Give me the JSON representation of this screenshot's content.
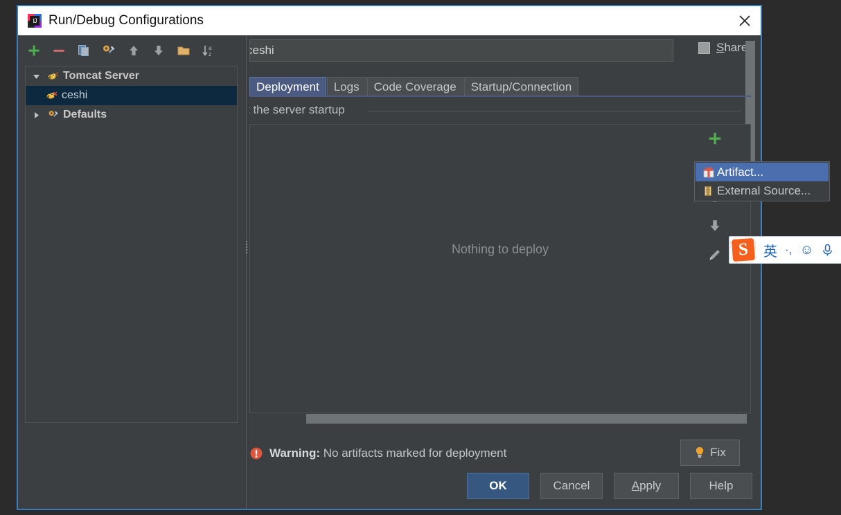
{
  "window": {
    "title": "Run/Debug Configurations",
    "app_icon": "intellij-idea-icon",
    "close_icon": "close-icon"
  },
  "left_toolbar": {
    "buttons": [
      {
        "name": "add-configuration-button",
        "icon": "plus-icon",
        "label": "+"
      },
      {
        "name": "remove-configuration-button",
        "icon": "minus-icon",
        "label": "-"
      },
      {
        "name": "copy-configuration-button",
        "icon": "copy-icon",
        "label": "Copy Configuration"
      },
      {
        "name": "edit-defaults-button",
        "icon": "wrench-gear-icon",
        "label": "Edit defaults"
      },
      {
        "name": "move-up-button",
        "icon": "arrow-up-icon",
        "label": "Move Up"
      },
      {
        "name": "move-down-button",
        "icon": "arrow-down-icon",
        "label": "Move Down"
      },
      {
        "name": "create-folder-button",
        "icon": "folder-icon",
        "label": "Create New Folder"
      },
      {
        "name": "sort-configurations-button",
        "icon": "sort-alpha-icon",
        "label": "Sort Configurations"
      }
    ]
  },
  "tree": {
    "nodes": [
      {
        "label": "Tomcat Server",
        "icon": "tomcat-icon",
        "expanded": true,
        "selected": false,
        "level": 0
      },
      {
        "label": "ceshi",
        "icon": "tomcat-icon",
        "expanded": null,
        "selected": true,
        "level": 1
      },
      {
        "label": "Defaults",
        "icon": "wrench-gear-icon",
        "expanded": false,
        "selected": false,
        "level": 0
      }
    ]
  },
  "name_field": {
    "value": "ceshi",
    "placeholder": "Name"
  },
  "share": {
    "label_prefix": "S",
    "label_rest": "hare",
    "checked": false
  },
  "tabs": [
    {
      "label": "Deployment",
      "active": true
    },
    {
      "label": "Logs",
      "active": false
    },
    {
      "label": "Code Coverage",
      "active": false
    },
    {
      "label": "Startup/Connection",
      "active": false
    }
  ],
  "deployment": {
    "caption": "t the server startup",
    "empty_text": "Nothing to deploy",
    "toolbar": [
      {
        "name": "add-artifact-button",
        "icon": "plus-icon"
      },
      {
        "name": "remove-artifact-button",
        "icon": "minus-icon"
      },
      {
        "name": "move-artifact-up-button",
        "icon": "arrow-up-icon"
      },
      {
        "name": "move-artifact-down-button",
        "icon": "arrow-down-icon"
      },
      {
        "name": "edit-artifact-button",
        "icon": "pencil-icon"
      }
    ]
  },
  "popup_menu": {
    "items": [
      {
        "label": "Artifact...",
        "icon": "artifact-package-icon",
        "highlighted": true
      },
      {
        "label": "External Source...",
        "icon": "external-source-icon",
        "highlighted": false
      }
    ]
  },
  "warning": {
    "icon": "error-circle-icon",
    "prefix": "Warning:",
    "message": "No artifacts marked for deployment",
    "fix_label": "Fix",
    "fix_icon": "quick-fix-bulb-icon"
  },
  "footer_buttons": [
    {
      "label": "OK",
      "name": "ok-button",
      "primary": true,
      "mnemonic": ""
    },
    {
      "label": "Cancel",
      "name": "cancel-button",
      "primary": false,
      "mnemonic": ""
    },
    {
      "label": "Apply",
      "name": "apply-button",
      "primary": false,
      "mnemonic": "A"
    },
    {
      "label": "Help",
      "name": "help-button",
      "primary": false,
      "mnemonic": ""
    }
  ],
  "ime": {
    "logo": "S",
    "mode": "英",
    "punctuation": "·,",
    "emoji": "☺",
    "voice": "mic-icon"
  },
  "colors": {
    "dialog_border": "#3c7eb8",
    "panel_bg": "#3c3f41",
    "selection_blue": "#4b6eaf",
    "tab_active": "#4b5a80",
    "primary_button": "#365880",
    "tree_selection": "#0d293f",
    "warning_red": "#e8523f",
    "ime_orange": "#f4601b"
  }
}
